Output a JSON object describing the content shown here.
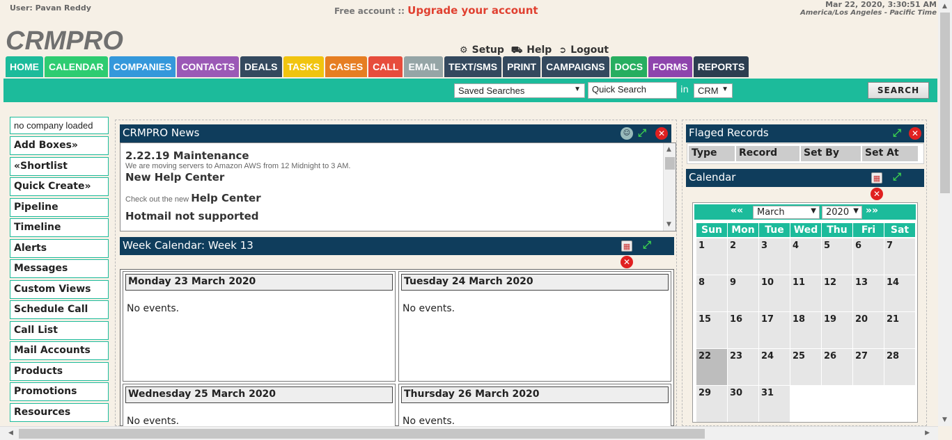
{
  "header": {
    "user": "User: Pavan Reddy",
    "free_account": "Free account ::",
    "upgrade": "Upgrade your account",
    "datetime": "Mar 22, 2020, 3:30:51 AM",
    "timezone": "America/Los Angeles - Pacific Time",
    "logo": "CRMPRO",
    "links": {
      "setup": "Setup",
      "help": "Help",
      "logout": "Logout"
    }
  },
  "nav": [
    {
      "label": "HOME",
      "color": "#1cbb9b"
    },
    {
      "label": "CALENDAR",
      "color": "#2ecc71"
    },
    {
      "label": "COMPANIES",
      "color": "#3498db"
    },
    {
      "label": "CONTACTS",
      "color": "#9b59b6"
    },
    {
      "label": "DEALS",
      "color": "#34495e"
    },
    {
      "label": "TASKS",
      "color": "#f1c40f"
    },
    {
      "label": "CASES",
      "color": "#e67e22"
    },
    {
      "label": "CALL",
      "color": "#e74c3c"
    },
    {
      "label": "EMAIL",
      "color": "#95a5a6"
    },
    {
      "label": "TEXT/SMS",
      "color": "#34495e"
    },
    {
      "label": "PRINT",
      "color": "#34495e"
    },
    {
      "label": "CAMPAIGNS",
      "color": "#34495e"
    },
    {
      "label": "DOCS",
      "color": "#27ae60"
    },
    {
      "label": "FORMS",
      "color": "#8e44ad"
    },
    {
      "label": "REPORTS",
      "color": "#2c3e50"
    }
  ],
  "search": {
    "saved_searches": "Saved Searches",
    "quick_search_placeholder": "Quick Search",
    "in_label": "in",
    "scope": "CRM",
    "button": "SEARCH"
  },
  "sidebar": {
    "company": "no company loaded",
    "items": [
      "Add Boxes»",
      "«Shortlist",
      "Quick Create»",
      "Pipeline",
      "Timeline",
      "Alerts",
      "Messages",
      "Custom Views",
      "Schedule Call",
      "Call List",
      "Mail Accounts",
      "Products",
      "Promotions",
      "Resources"
    ]
  },
  "news": {
    "title": "CRMPRO News",
    "items": [
      {
        "heading": "2.22.19 Maintenance",
        "text": "We are moving servers to Amazon AWS from 12 Midnight to 3 AM."
      },
      {
        "heading": "New Help Center",
        "text": ""
      },
      {
        "prefix": "Check out the new",
        "heading": "Help Center"
      },
      {
        "heading": "Hotmail not supported"
      }
    ]
  },
  "week": {
    "title": "Week Calendar: Week 13",
    "days": [
      {
        "label": "Monday 23 March 2020",
        "events": "No events."
      },
      {
        "label": "Tuesday 24 March 2020",
        "events": "No events."
      },
      {
        "label": "Wednesday 25 March 2020",
        "events": "No events."
      },
      {
        "label": "Thursday 26 March 2020",
        "events": "No events."
      }
    ]
  },
  "flagged": {
    "title": "Flaged Records",
    "columns": [
      "Type",
      "Record",
      "Set By",
      "Set At"
    ]
  },
  "calendar": {
    "title": "Calendar",
    "prev": "««",
    "next": "»»",
    "month": "March",
    "year": "2020",
    "dow": [
      "Sun",
      "Mon",
      "Tue",
      "Wed",
      "Thu",
      "Fri",
      "Sat"
    ],
    "weeks": [
      [
        "1",
        "2",
        "3",
        "4",
        "5",
        "6",
        "7"
      ],
      [
        "8",
        "9",
        "10",
        "11",
        "12",
        "13",
        "14"
      ],
      [
        "15",
        "16",
        "17",
        "18",
        "19",
        "20",
        "21"
      ],
      [
        "22",
        "23",
        "24",
        "25",
        "26",
        "27",
        "28"
      ],
      [
        "29",
        "30",
        "31",
        "",
        "",
        "",
        ""
      ]
    ],
    "today": "22"
  }
}
